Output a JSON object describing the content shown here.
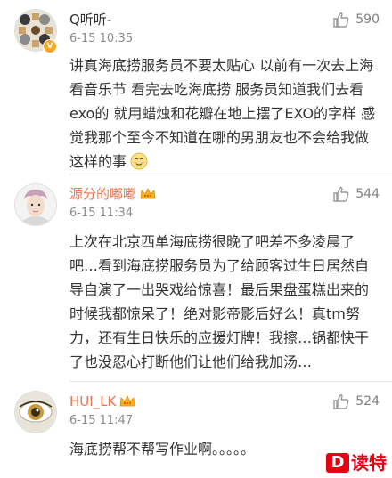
{
  "comments": [
    {
      "username": "Q听听-",
      "time": "6-15 10:35",
      "likes": "590",
      "text": "讲真海底捞服务员不要太贴心 以前有一次去上海看音乐节 看完去吃海底捞 服务员知道我们去看exo的 就用蜡烛和花瓣在地上摆了EXO的字样 感觉我那个至今不知道在哪的男朋友也不会给我做这样的事",
      "emoji": "smirk-emoji",
      "avatar": "pattern-avatar",
      "badge": "v-badge"
    },
    {
      "username": "源分的嘟嘟",
      "time": "6-15 11:34",
      "likes": "544",
      "text": "上次在北京西单海底捞很晚了吧差不多凌晨了吧…看到海底捞服务员为了给顾客过生日居然自导自演了一出哭戏给惊喜！最后果盘蛋糕出来的时候我都惊呆了！绝对影帝影后好么！真tm努力，还有生日快乐的应援灯牌！我擦…锅都快干了也没忍心打断他们让他们给我加汤…",
      "avatar": "person-avatar",
      "vip": true
    },
    {
      "username": "HUI_LK",
      "time": "6-15 11:47",
      "likes": "524",
      "text": "海底捞帮不帮写作业啊。。。。。",
      "avatar": "eye-avatar",
      "vip": true
    }
  ],
  "watermark": {
    "logo": "D",
    "text": "读特"
  },
  "colors": {
    "vip_name": "#eb7350",
    "text": "#333333",
    "muted": "#8c8c8c",
    "brand": "#e60012"
  }
}
